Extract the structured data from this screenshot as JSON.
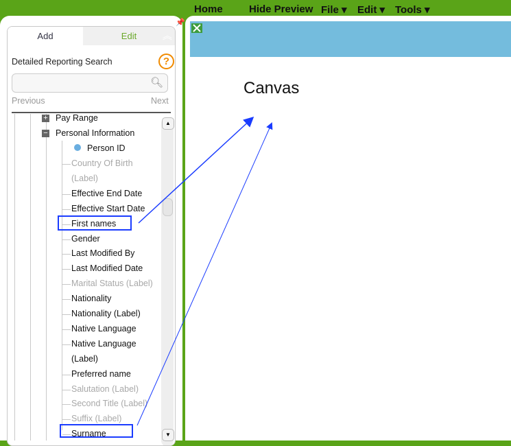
{
  "menu": {
    "items": [
      "Home",
      "Hide Preview",
      "File ▾",
      "Edit ▾",
      "Tools ▾"
    ]
  },
  "canvas": {
    "label": "Canvas"
  },
  "panel": {
    "tabs": {
      "add": "Add",
      "edit": "Edit"
    },
    "search_title": "Detailed Reporting Search",
    "search_placeholder": "",
    "previous": "Previous",
    "next": "Next",
    "tree": {
      "pay_range": "Pay Range",
      "personal_information": "Personal Information",
      "person_id": "Person ID",
      "items": [
        {
          "label": "Country Of Birth",
          "grey": true
        },
        {
          "label": "(Label)",
          "grey": true,
          "cont": true
        },
        {
          "label": "Effective End Date"
        },
        {
          "label": "Effective Start Date"
        },
        {
          "label": "First names",
          "highlight": true
        },
        {
          "label": "Gender"
        },
        {
          "label": "Last Modified By"
        },
        {
          "label": "Last Modified Date"
        },
        {
          "label": "Marital Status (Label)",
          "grey": true
        },
        {
          "label": "Nationality"
        },
        {
          "label": "Nationality (Label)"
        },
        {
          "label": "Native Language"
        },
        {
          "label": "Native Language"
        },
        {
          "label": "(Label)",
          "cont": true
        },
        {
          "label": "Preferred name"
        },
        {
          "label": "Salutation (Label)",
          "grey": true
        },
        {
          "label": "Second Title (Label)",
          "grey": true
        },
        {
          "label": "Suffix (Label)",
          "grey": true
        },
        {
          "label": "Surname",
          "highlight": true
        }
      ]
    }
  },
  "colors": {
    "green": "#5aa418",
    "preview": "#74bcdd",
    "annotation": "#1a3cff",
    "help": "#f08a00"
  }
}
